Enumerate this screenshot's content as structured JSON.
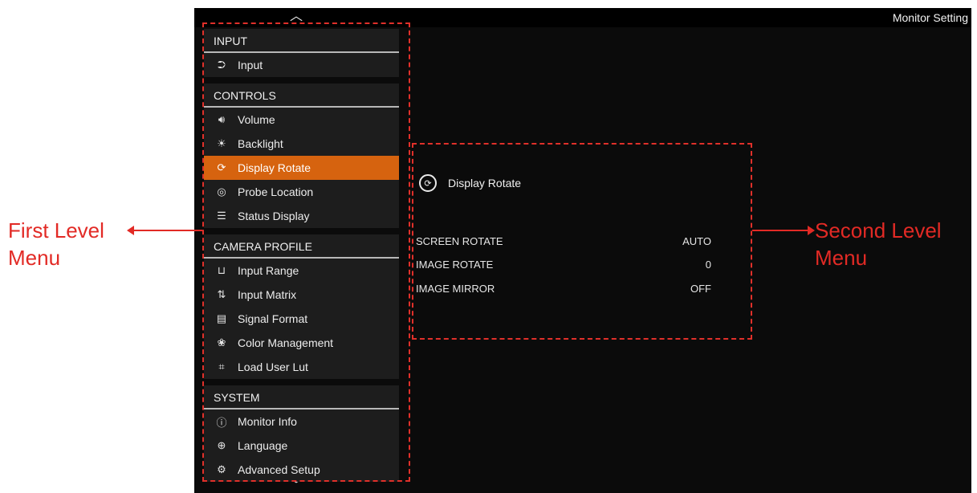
{
  "window": {
    "title": "Monitor Setting"
  },
  "nav": {
    "scroll_up_icon": "chevron-up-icon",
    "scroll_down_icon": "chevron-down-icon"
  },
  "sidebar": {
    "sections": [
      {
        "header": "INPUT",
        "items": [
          {
            "label": "Input",
            "icon": "input-icon",
            "glyph": "⮊"
          }
        ]
      },
      {
        "header": "CONTROLS",
        "items": [
          {
            "label": "Volume",
            "icon": "volume-icon",
            "glyph": "🔊︎"
          },
          {
            "label": "Backlight",
            "icon": "backlight-icon",
            "glyph": "☀"
          },
          {
            "label": "Display Rotate",
            "icon": "display-rotate-icon",
            "glyph": "⟳",
            "active": true
          },
          {
            "label": "Probe Location",
            "icon": "probe-location-icon",
            "glyph": "◎"
          },
          {
            "label": "Status Display",
            "icon": "status-display-icon",
            "glyph": "☰"
          }
        ]
      },
      {
        "header": "CAMERA PROFILE",
        "items": [
          {
            "label": "Input Range",
            "icon": "input-range-icon",
            "glyph": "⊔"
          },
          {
            "label": "Input Matrix",
            "icon": "input-matrix-icon",
            "glyph": "⇅"
          },
          {
            "label": "Signal Format",
            "icon": "signal-format-icon",
            "glyph": "▤"
          },
          {
            "label": "Color Management",
            "icon": "color-management-icon",
            "glyph": "❀"
          },
          {
            "label": "Load User Lut",
            "icon": "load-user-lut-icon",
            "glyph": "⌗"
          }
        ]
      },
      {
        "header": "SYSTEM",
        "items": [
          {
            "label": "Monitor Info",
            "icon": "monitor-info-icon",
            "glyph": "ⓘ"
          },
          {
            "label": "Language",
            "icon": "language-icon",
            "glyph": "⊕"
          },
          {
            "label": "Advanced Setup",
            "icon": "advanced-setup-icon",
            "glyph": "⚙"
          }
        ]
      }
    ]
  },
  "panel": {
    "title": "Display Rotate",
    "icon": "display-rotate-icon",
    "rows": [
      {
        "label": "SCREEN ROTATE",
        "value": "AUTO"
      },
      {
        "label": "IMAGE ROTATE",
        "value": "0"
      },
      {
        "label": "IMAGE MIRROR",
        "value": "OFF"
      }
    ]
  },
  "annotations": {
    "first_level": "First Level\nMenu",
    "second_level": "Second Level\nMenu"
  },
  "colors": {
    "accent": "#d6630f",
    "annotation": "#e22a25",
    "screen_bg": "#0b0b0b",
    "section_bg": "#1d1d1d"
  }
}
